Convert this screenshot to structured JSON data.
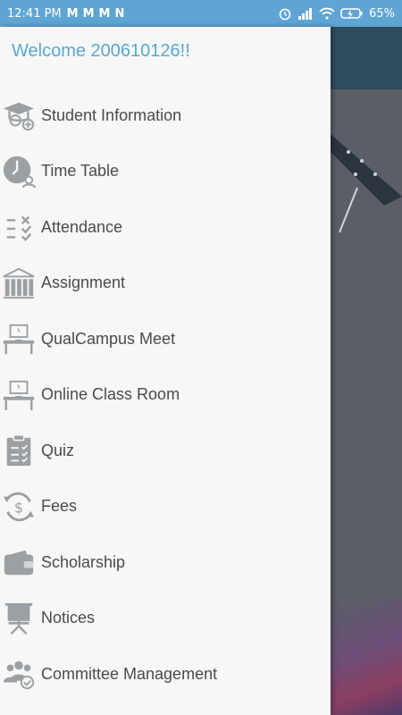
{
  "status_bar": {
    "time": "12:41 PM",
    "notification_icons": [
      "gmail-icon",
      "gmail-icon",
      "gmail-icon",
      "n-app-icon"
    ],
    "battery": "65%"
  },
  "drawer": {
    "welcome": "Welcome 200610126!!",
    "items": [
      {
        "label": "Student Information",
        "icon": "graduate-add-icon"
      },
      {
        "label": "Time Table",
        "icon": "clock-person-icon"
      },
      {
        "label": "Attendance",
        "icon": "checklist-icon"
      },
      {
        "label": "Assignment",
        "icon": "books-icon"
      },
      {
        "label": "QualCampus Meet",
        "icon": "desk-computer-icon"
      },
      {
        "label": "Online Class Room",
        "icon": "desk-computer-icon"
      },
      {
        "label": "Quiz",
        "icon": "clipboard-icon"
      },
      {
        "label": "Fees",
        "icon": "dollar-refresh-icon"
      },
      {
        "label": "Scholarship",
        "icon": "wallet-icon"
      },
      {
        "label": "Notices",
        "icon": "easel-icon"
      },
      {
        "label": "Committee Management",
        "icon": "group-check-icon"
      }
    ]
  },
  "colors": {
    "status_bar": "#5fa5d3",
    "welcome_text": "#5aa7cf",
    "icon_gray": "#9aa0a4",
    "label_text": "#4a4a4a"
  }
}
